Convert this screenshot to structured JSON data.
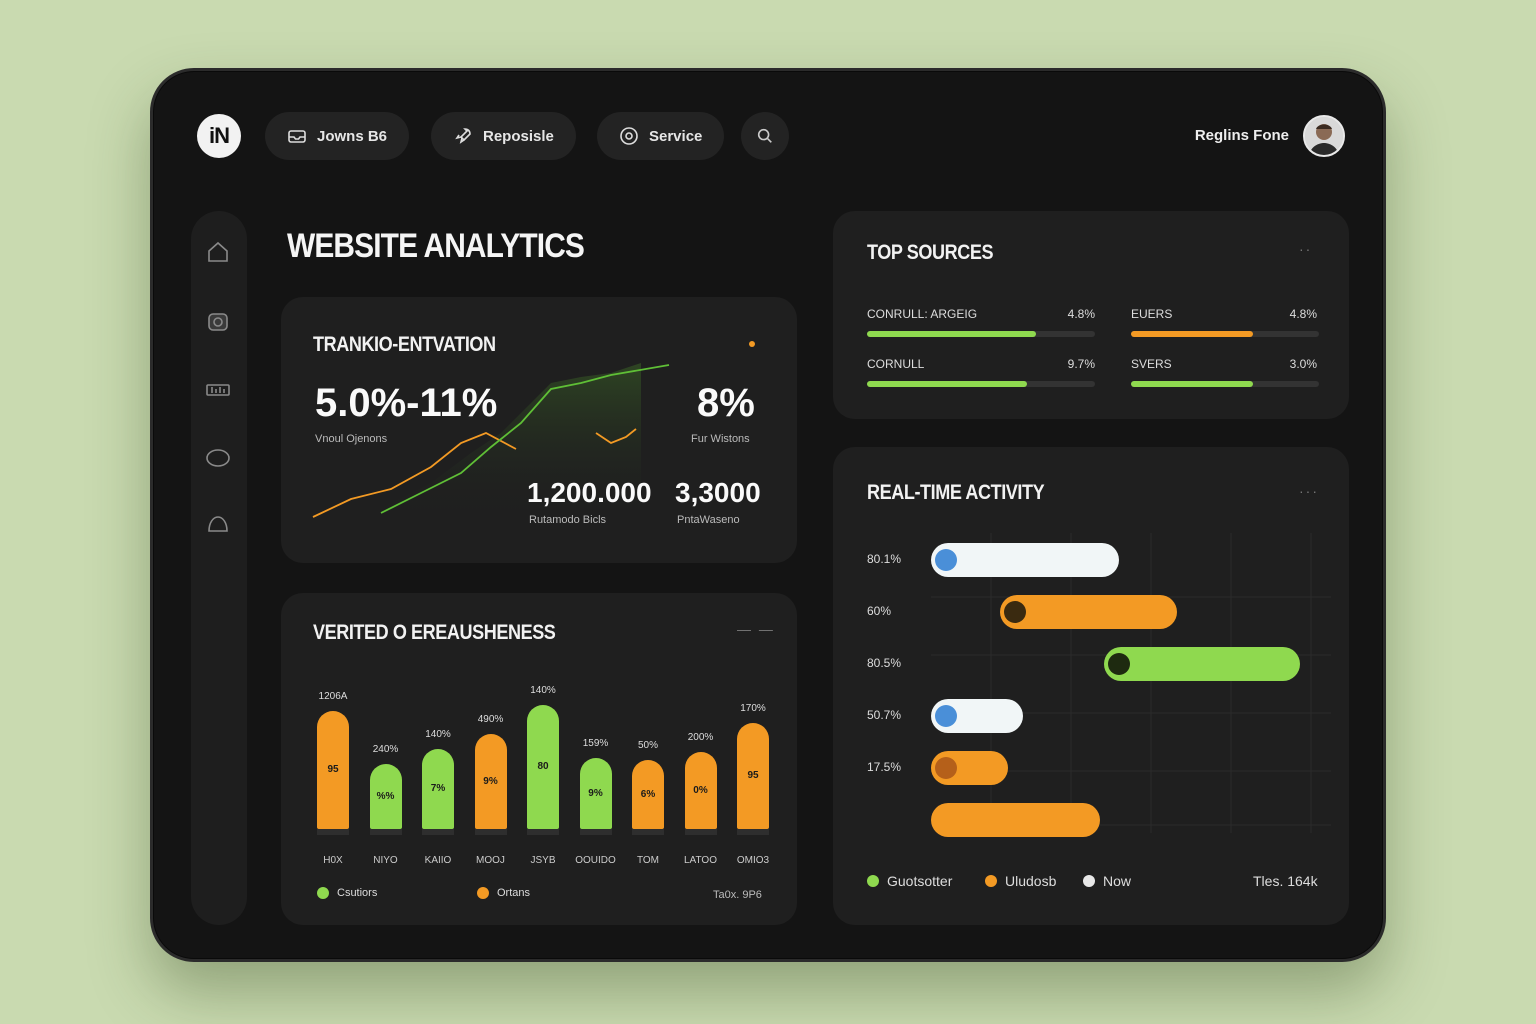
{
  "colors": {
    "green": "#8fd94f",
    "orange": "#f39a24",
    "white_bar": "#f1f6f7",
    "blue_dot": "#4a8fd8"
  },
  "header": {
    "logo_text": "iN",
    "nav": [
      {
        "label": "Jowns B6",
        "icon": "inbox-icon"
      },
      {
        "label": "Reposisle",
        "icon": "rocket-icon"
      },
      {
        "label": "Service",
        "icon": "at-icon"
      }
    ],
    "user_name": "Reglins Fone"
  },
  "page_title": "WEBSITE ANALYTICS",
  "traffic_card": {
    "title": "TRANKIO-ENTVATION",
    "range_value": "5.0%-11%",
    "range_caption": "Vnoul Ojenons",
    "pct_value": "8%",
    "pct_caption": "Fur Wistons",
    "total_value": "1,200.000",
    "total_caption": "Rutamodo Bicls",
    "other_value": "3,3000",
    "other_caption": "PntaWaseno"
  },
  "engagement_card": {
    "title": "VERITED O EREAUSHENESS",
    "menu": "— —",
    "legend": [
      {
        "label": "Csutiors",
        "color": "#8fd94f"
      },
      {
        "label": "Ortans",
        "color": "#f39a24"
      }
    ],
    "footer": "Ta0x. 9P6"
  },
  "chart_data": {
    "type": "bar",
    "categories": [
      "H0X",
      "NIYO",
      "KAIIO",
      "MOOJ",
      "JSYB",
      "OOUIDO",
      "TOM",
      "LATOO",
      "OMIO3"
    ],
    "top_labels": [
      "1206A",
      "240%",
      "140%",
      "490%",
      "140%",
      "159%",
      "50%",
      "200%",
      "170%"
    ],
    "inner_labels": [
      "95",
      "%%",
      "7%",
      "9%",
      "80",
      "9%",
      "6%",
      "0%",
      "95"
    ],
    "values": [
      100,
      55,
      68,
      80,
      105,
      60,
      58,
      65,
      90
    ],
    "colors": [
      "orange",
      "green",
      "green",
      "orange",
      "green",
      "green",
      "orange",
      "orange",
      "orange"
    ],
    "ylim": [
      0,
      110
    ]
  },
  "sources_card": {
    "title": "TOP SOURCES",
    "rows": [
      {
        "label": "CONRULL: ARGEIG",
        "pct": "4.8%",
        "fill": 0.74,
        "color": "#8fd94f"
      },
      {
        "label": "EUERS",
        "pct": "4.8%",
        "fill": 0.65,
        "color": "#f39a24"
      },
      {
        "label": "CORNULL",
        "pct": "9.7%",
        "fill": 0.7,
        "color": "#8fd94f"
      },
      {
        "label": "SVERS",
        "pct": "3.0%",
        "fill": 0.65,
        "color": "#8fd94f"
      }
    ]
  },
  "realtime_card": {
    "title": "REAL-TIME ACTIVITY",
    "rows": [
      {
        "label": "80.1%",
        "start": 0.0,
        "end": 0.49,
        "color": "#f1f6f7",
        "dot": "#4a8fd8"
      },
      {
        "label": "60%",
        "start": 0.18,
        "end": 0.64,
        "color": "#f39a24",
        "dot": "#3a2a10"
      },
      {
        "label": "80.5%",
        "start": 0.45,
        "end": 0.96,
        "color": "#8fd94f",
        "dot": "#1e2a10"
      },
      {
        "label": "50.7%",
        "start": 0.0,
        "end": 0.24,
        "color": "#f1f6f7",
        "dot": "#4a8fd8"
      },
      {
        "label": "17.5%",
        "start": 0.0,
        "end": 0.2,
        "color": "#f39a24",
        "dot": "#b5601a"
      },
      {
        "label": "",
        "start": 0.0,
        "end": 0.44,
        "color": "#f39a24",
        "dot": ""
      }
    ],
    "legend": [
      {
        "label": "Guotsotter",
        "color": "#8fd94f"
      },
      {
        "label": "Uludosb",
        "color": "#f39a24"
      },
      {
        "label": "Now",
        "color": "#e8e8e8"
      }
    ],
    "footer": "Tles. 164k"
  }
}
